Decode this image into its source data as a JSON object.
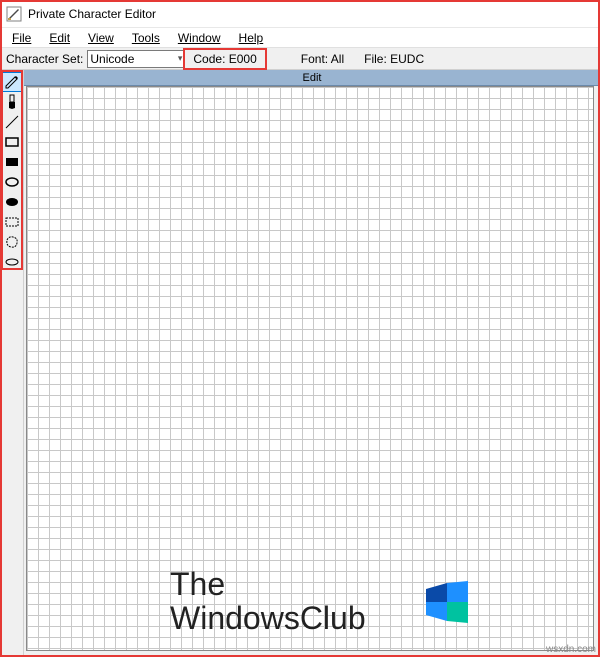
{
  "titlebar": {
    "title": "Private Character Editor"
  },
  "menubar": {
    "file": "File",
    "edit": "Edit",
    "view": "View",
    "tools": "Tools",
    "window": "Window",
    "help": "Help"
  },
  "infobar": {
    "charset_label": "Character Set:",
    "charset_value": "Unicode",
    "code_label": "Code: E000",
    "font_label": "Font: All",
    "file_label": "File: EUDC"
  },
  "tools": {
    "pencil": "pencil",
    "brush": "brush",
    "line": "line",
    "rect": "rectangle",
    "rect_filled": "filled-rectangle",
    "ellipse": "ellipse",
    "ellipse_filled": "filled-ellipse",
    "select_rect": "rect-select",
    "select_free": "free-select",
    "eraser": "eraser"
  },
  "canvas": {
    "title": "Edit"
  },
  "watermark": {
    "line1": "The",
    "line2": "WindowsClub"
  },
  "credit": "wsxdn.com"
}
